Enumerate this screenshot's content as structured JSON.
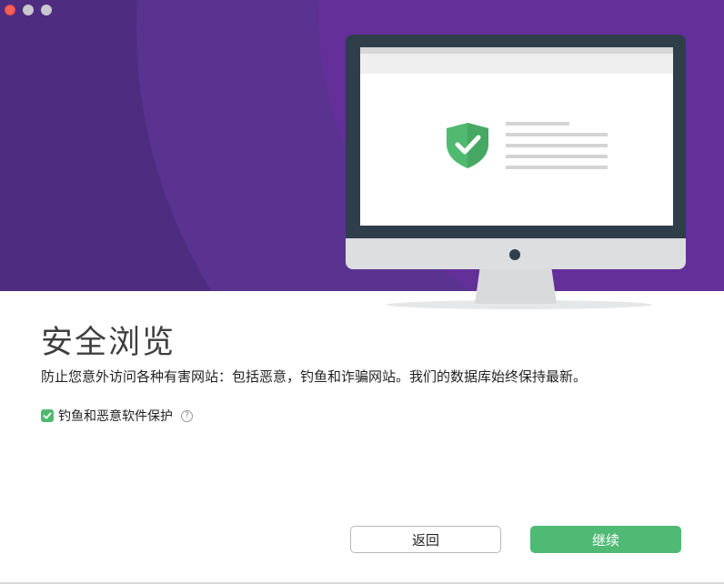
{
  "window": {
    "controls": [
      "close",
      "minimize",
      "maximize"
    ]
  },
  "hero": {
    "colors": {
      "primary": "#4e2d80",
      "mid": "#5a3290",
      "light": "#632f98"
    },
    "illustration": {
      "icon": "shield-check-icon",
      "shield_color": "#4fba6f"
    }
  },
  "content": {
    "title": "安全浏览",
    "description": "防止您意外访问各种有害网站：包括恶意，钓鱼和诈骗网站。我们的数据库始终保持最新。",
    "option": {
      "label": "钓鱼和恶意软件保护",
      "checked": true,
      "help_icon": "?"
    }
  },
  "buttons": {
    "back_label": "返回",
    "continue_label": "继续"
  },
  "colors": {
    "accent": "#4fba74",
    "checkbox": "#4fba6f"
  }
}
